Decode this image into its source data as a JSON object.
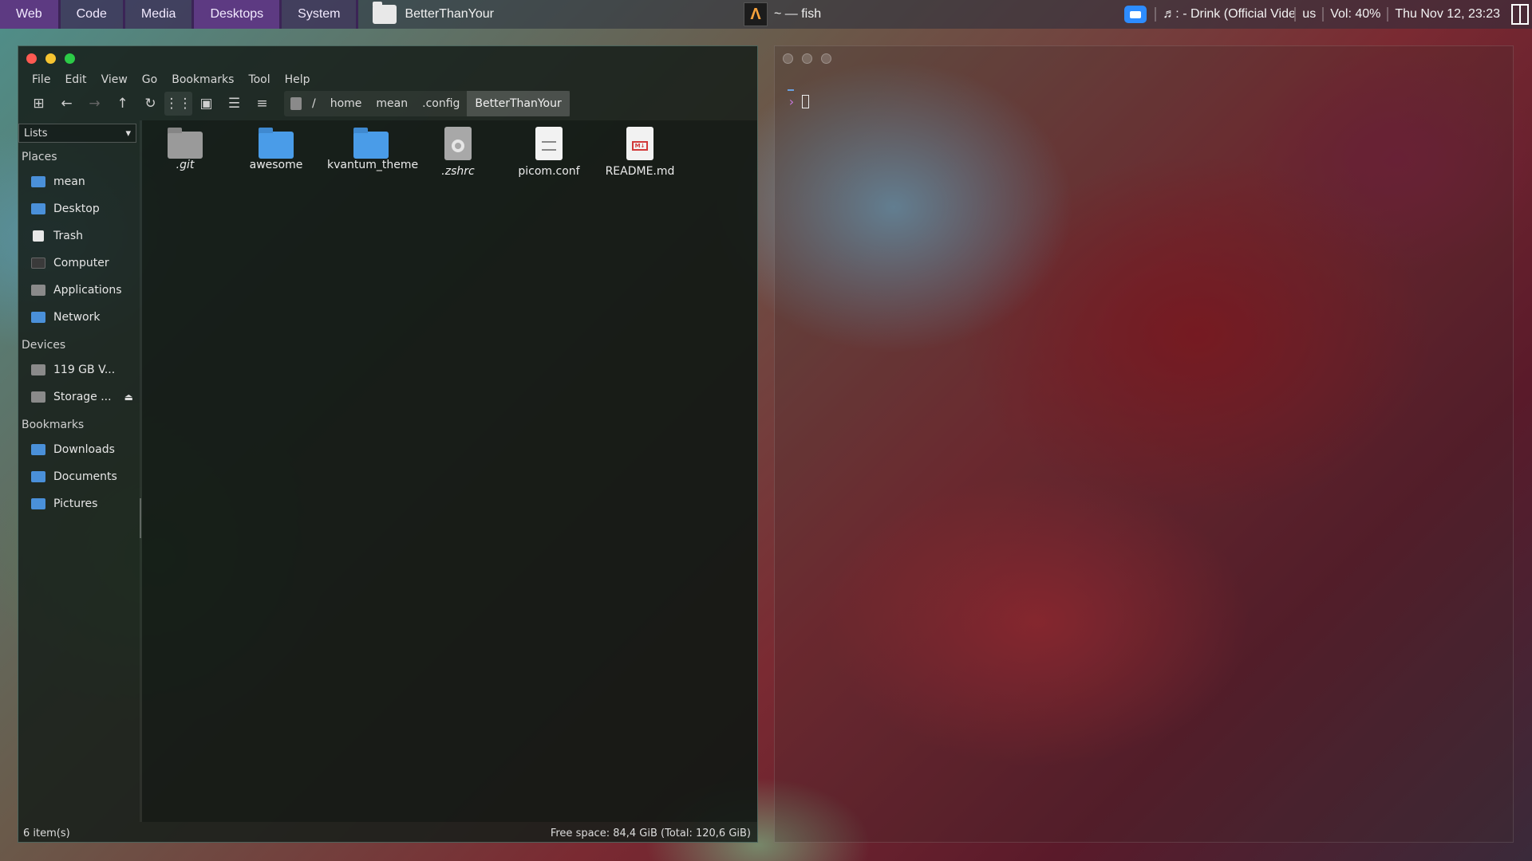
{
  "topbar": {
    "tags": [
      "Web",
      "Code",
      "Media",
      "Desktops",
      "System"
    ],
    "active_task": "BetterThanYour",
    "terminal_task": "~ — fish",
    "music": "♬: - Drink (Official Video",
    "layout": "us",
    "volume": "Vol: 40%",
    "clock": "Thu Nov 12, 23:23"
  },
  "filemanager": {
    "menu": [
      "File",
      "Edit",
      "View",
      "Go",
      "Bookmarks",
      "Tool",
      "Help"
    ],
    "breadcrumb": [
      "/",
      "home",
      "mean",
      ".config",
      "BetterThanYour"
    ],
    "sidebar_mode": "Lists",
    "places_heading": "Places",
    "places": [
      "mean",
      "Desktop",
      "Trash",
      "Computer",
      "Applications",
      "Network"
    ],
    "devices_heading": "Devices",
    "devices": [
      "119 GB V...",
      "Storage ..."
    ],
    "bookmarks_heading": "Bookmarks",
    "bookmarks": [
      "Downloads",
      "Documents",
      "Pictures"
    ],
    "files": [
      ".git",
      "awesome",
      "kvantum_theme",
      ".zshrc",
      "picom.conf",
      "README.md"
    ],
    "status_left": "6 item(s)",
    "status_right": "Free space: 84,4 GiB (Total: 120,6 GiB)"
  },
  "terminal": {
    "prompt": "›"
  }
}
